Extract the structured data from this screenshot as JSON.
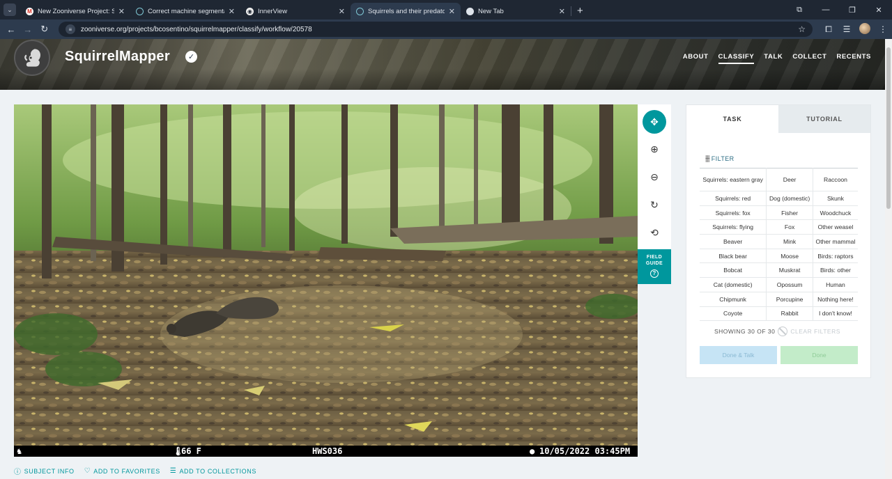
{
  "browser": {
    "tabs": [
      {
        "title": "New Zooniverse Project: Scienc",
        "favicon": "gmail-icon",
        "active": false
      },
      {
        "title": "Correct machine segmentation",
        "favicon": "zooniverse-icon",
        "active": false
      },
      {
        "title": "InnerView",
        "favicon": "innerview-icon",
        "active": false
      },
      {
        "title": "Squirrels and their predators! |",
        "favicon": "zooniverse-icon",
        "active": true
      },
      {
        "title": "New Tab",
        "favicon": "chrome-icon",
        "active": false
      }
    ],
    "url": "zooniverse.org/projects/bcosentino/squirrelmapper/classify/workflow/20578"
  },
  "project": {
    "title": "SquirrelMapper",
    "nav": [
      {
        "label": "ABOUT",
        "active": false
      },
      {
        "label": "CLASSIFY",
        "active": true
      },
      {
        "label": "TALK",
        "active": false
      },
      {
        "label": "COLLECT",
        "active": false
      },
      {
        "label": "RECENTS",
        "active": false
      }
    ]
  },
  "subject": {
    "temperature": "66 F",
    "camera_id": "HWS036",
    "datetime": "10/05/2022 03:45PM"
  },
  "image_tools": {
    "field_guide_line1": "FIELD",
    "field_guide_line2": "GUIDE"
  },
  "subject_links": {
    "info": "SUBJECT INFO",
    "favorites": "ADD TO FAVORITES",
    "collections": "ADD TO COLLECTIONS"
  },
  "task": {
    "tab_task": "TASK",
    "tab_tutorial": "TUTORIAL",
    "filter_label": "FILTER",
    "choices": [
      [
        "Squirrels: eastern gray",
        "Deer",
        "Raccoon"
      ],
      [
        "Squirrels: red",
        "Dog (domestic)",
        "Skunk"
      ],
      [
        "Squirrels: fox",
        "Fisher",
        "Woodchuck"
      ],
      [
        "Squirrels: flying",
        "Fox",
        "Other weasel"
      ],
      [
        "Beaver",
        "Mink",
        "Other mammal"
      ],
      [
        "Black bear",
        "Moose",
        "Birds: raptors"
      ],
      [
        "Bobcat",
        "Muskrat",
        "Birds: other"
      ],
      [
        "Cat (domestic)",
        "Opossum",
        "Human"
      ],
      [
        "Chipmunk",
        "Porcupine",
        "Nothing here!"
      ],
      [
        "Coyote",
        "Rabbit",
        "I don't know!"
      ]
    ],
    "showing": "SHOWING 30 OF 30",
    "clear_filters": "CLEAR FILTERS",
    "done_talk": "Done & Talk",
    "done": "Done"
  },
  "colors": {
    "accent": "#00979d",
    "done_talk_bg": "#c6e4f5",
    "done_bg": "#c3ecc9"
  }
}
